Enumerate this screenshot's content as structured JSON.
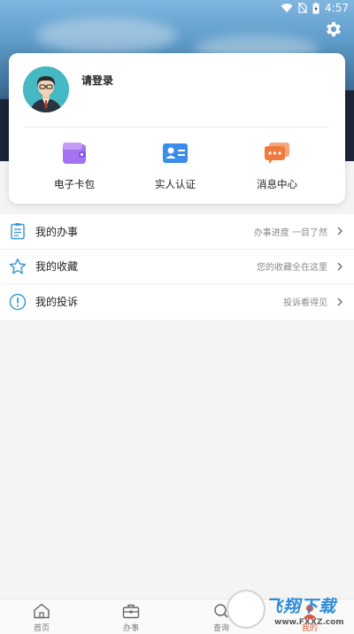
{
  "status_bar": {
    "time": "4:57",
    "icons": [
      "wifi-icon",
      "no-sim-icon",
      "battery-icon"
    ]
  },
  "header": {
    "settings_icon": "gear-icon"
  },
  "profile": {
    "login_prompt": "请登录",
    "avatar_icon": "user-avatar"
  },
  "quick_actions": [
    {
      "label": "电子卡包",
      "icon": "wallet-icon",
      "color": "#a472f3"
    },
    {
      "label": "实人认证",
      "icon": "id-card-icon",
      "color": "#3a8ee8"
    },
    {
      "label": "消息中心",
      "icon": "message-icon",
      "color": "#f07a3e"
    }
  ],
  "menu": [
    {
      "title": "我的办事",
      "desc": "办事进度 一目了然",
      "icon": "clipboard-icon"
    },
    {
      "title": "我的收藏",
      "desc": "您的收藏全在这里",
      "icon": "star-icon"
    },
    {
      "title": "我的投诉",
      "desc": "投诉看得见",
      "icon": "alert-icon"
    }
  ],
  "tabbar": [
    {
      "label": "首页",
      "icon": "home-icon",
      "active": false
    },
    {
      "label": "办事",
      "icon": "briefcase-icon",
      "active": false
    },
    {
      "label": "查询",
      "icon": "search-icon",
      "active": false
    },
    {
      "label": "我的",
      "icon": "user-icon",
      "active": true
    }
  ],
  "watermark": {
    "title": "飞翔下载",
    "url": "www.FXXZ.com"
  },
  "colors": {
    "accent": "#3a9bdc",
    "active_tab": "#e0563b"
  }
}
